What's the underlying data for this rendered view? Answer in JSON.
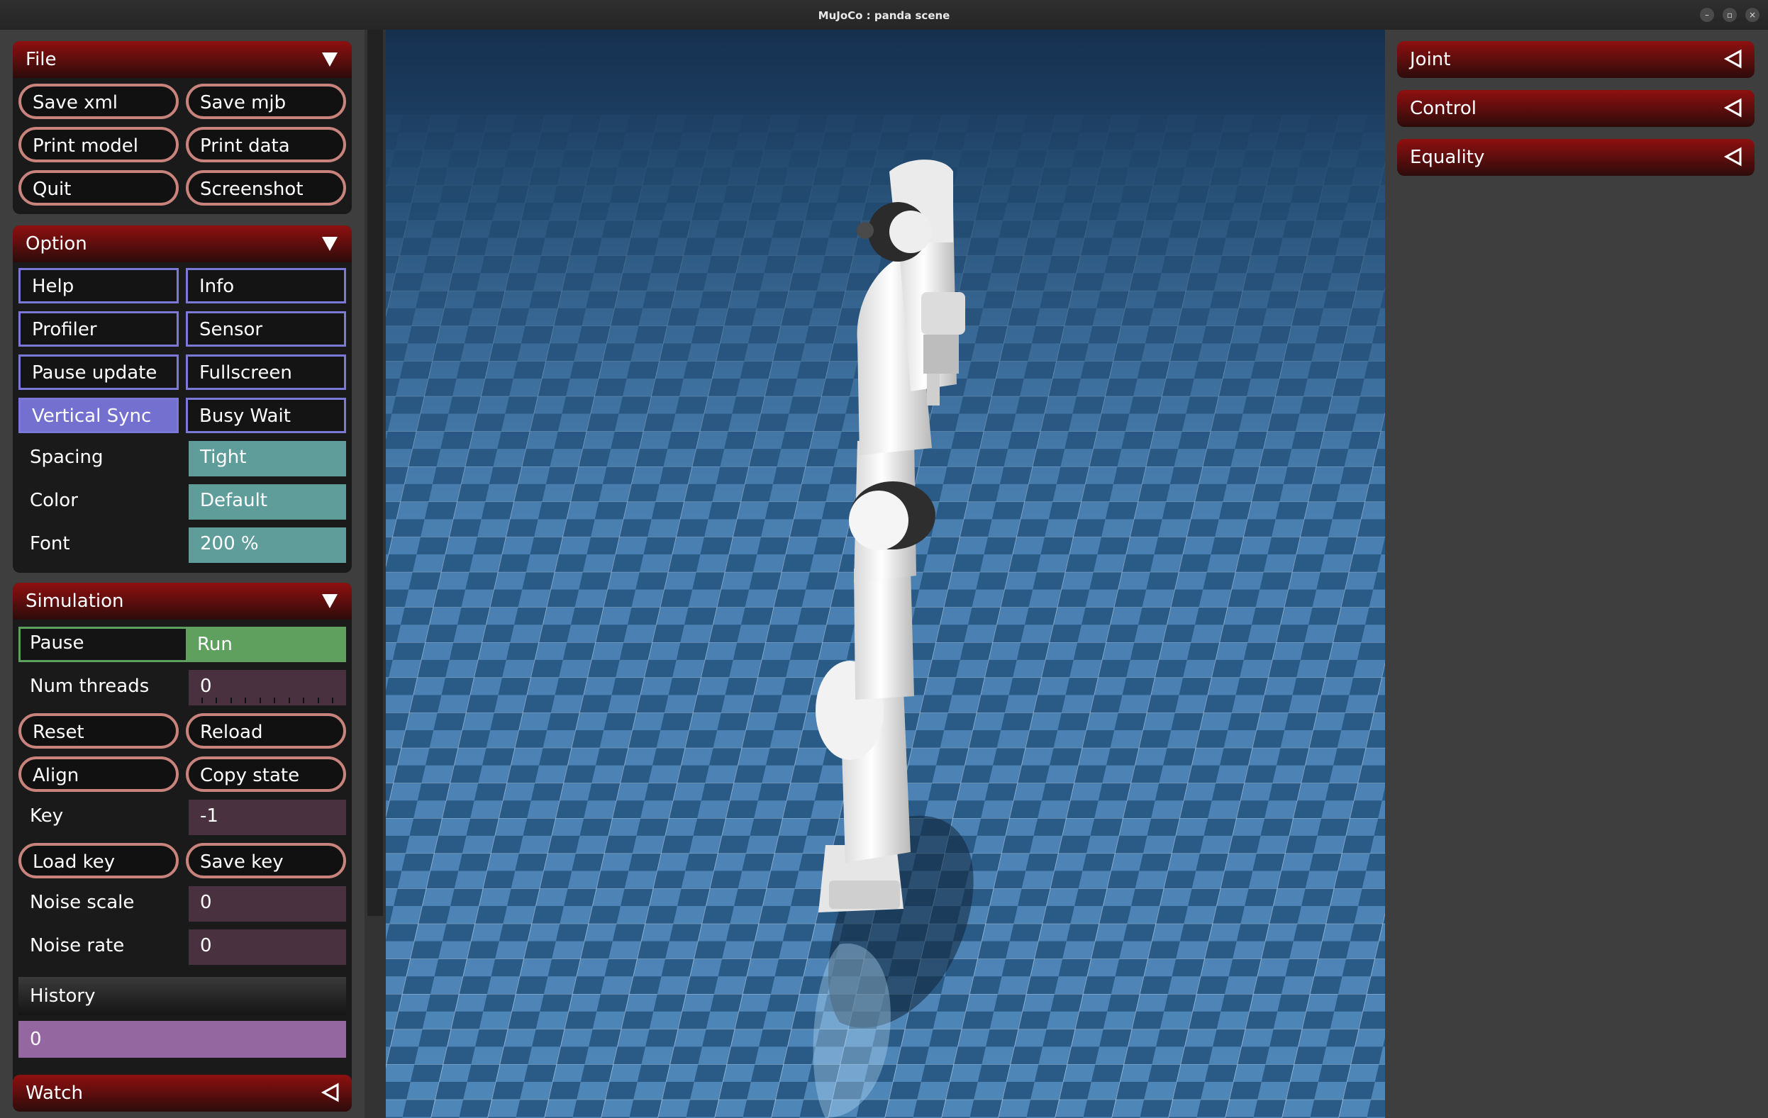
{
  "window": {
    "title": "MuJoCo : panda scene",
    "controls": [
      "–",
      "▫",
      "×"
    ]
  },
  "file": {
    "header": "File",
    "buttons": [
      "Save xml",
      "Save mjb",
      "Print model",
      "Print data",
      "Quit",
      "Screenshot"
    ]
  },
  "option": {
    "header": "Option",
    "checkboxes": [
      {
        "label": "Help",
        "checked": false
      },
      {
        "label": "Info",
        "checked": false
      },
      {
        "label": "Profiler",
        "checked": false
      },
      {
        "label": "Sensor",
        "checked": false
      },
      {
        "label": "Pause update",
        "checked": false
      },
      {
        "label": "Fullscreen",
        "checked": false
      },
      {
        "label": "Vertical Sync",
        "checked": true
      },
      {
        "label": "Busy Wait",
        "checked": false
      }
    ],
    "spacing_label": "Spacing",
    "spacing_value": "Tight",
    "color_label": "Color",
    "color_value": "Default",
    "font_label": "Font",
    "font_value": "200 %"
  },
  "simulation": {
    "header": "Simulation",
    "pause_label": "Pause",
    "run_label": "Run",
    "selected": "Run",
    "num_threads_label": "Num threads",
    "num_threads_value": "0",
    "reset_label": "Reset",
    "reload_label": "Reload",
    "align_label": "Align",
    "copy_state_label": "Copy state",
    "key_label": "Key",
    "key_value": "-1",
    "load_key_label": "Load key",
    "save_key_label": "Save key",
    "noise_scale_label": "Noise scale",
    "noise_scale_value": "0",
    "noise_rate_label": "Noise rate",
    "noise_rate_value": "0",
    "history_label": "History",
    "history_value": "0"
  },
  "watch": {
    "header": "Watch"
  },
  "right": {
    "joint": "Joint",
    "control": "Control",
    "equality": "Equality"
  },
  "colors": {
    "header_red": "#8e1010",
    "pill_border": "#c9837d",
    "check_border": "#7b78d8",
    "check_on": "#7370cf",
    "select_teal": "#5f9d9b",
    "radio_green": "#5fa05f",
    "slider_plum": "#49313f",
    "history_purple": "#9567a0",
    "floor_light": "#4f86b8",
    "floor_dark": "#2a5a86"
  }
}
